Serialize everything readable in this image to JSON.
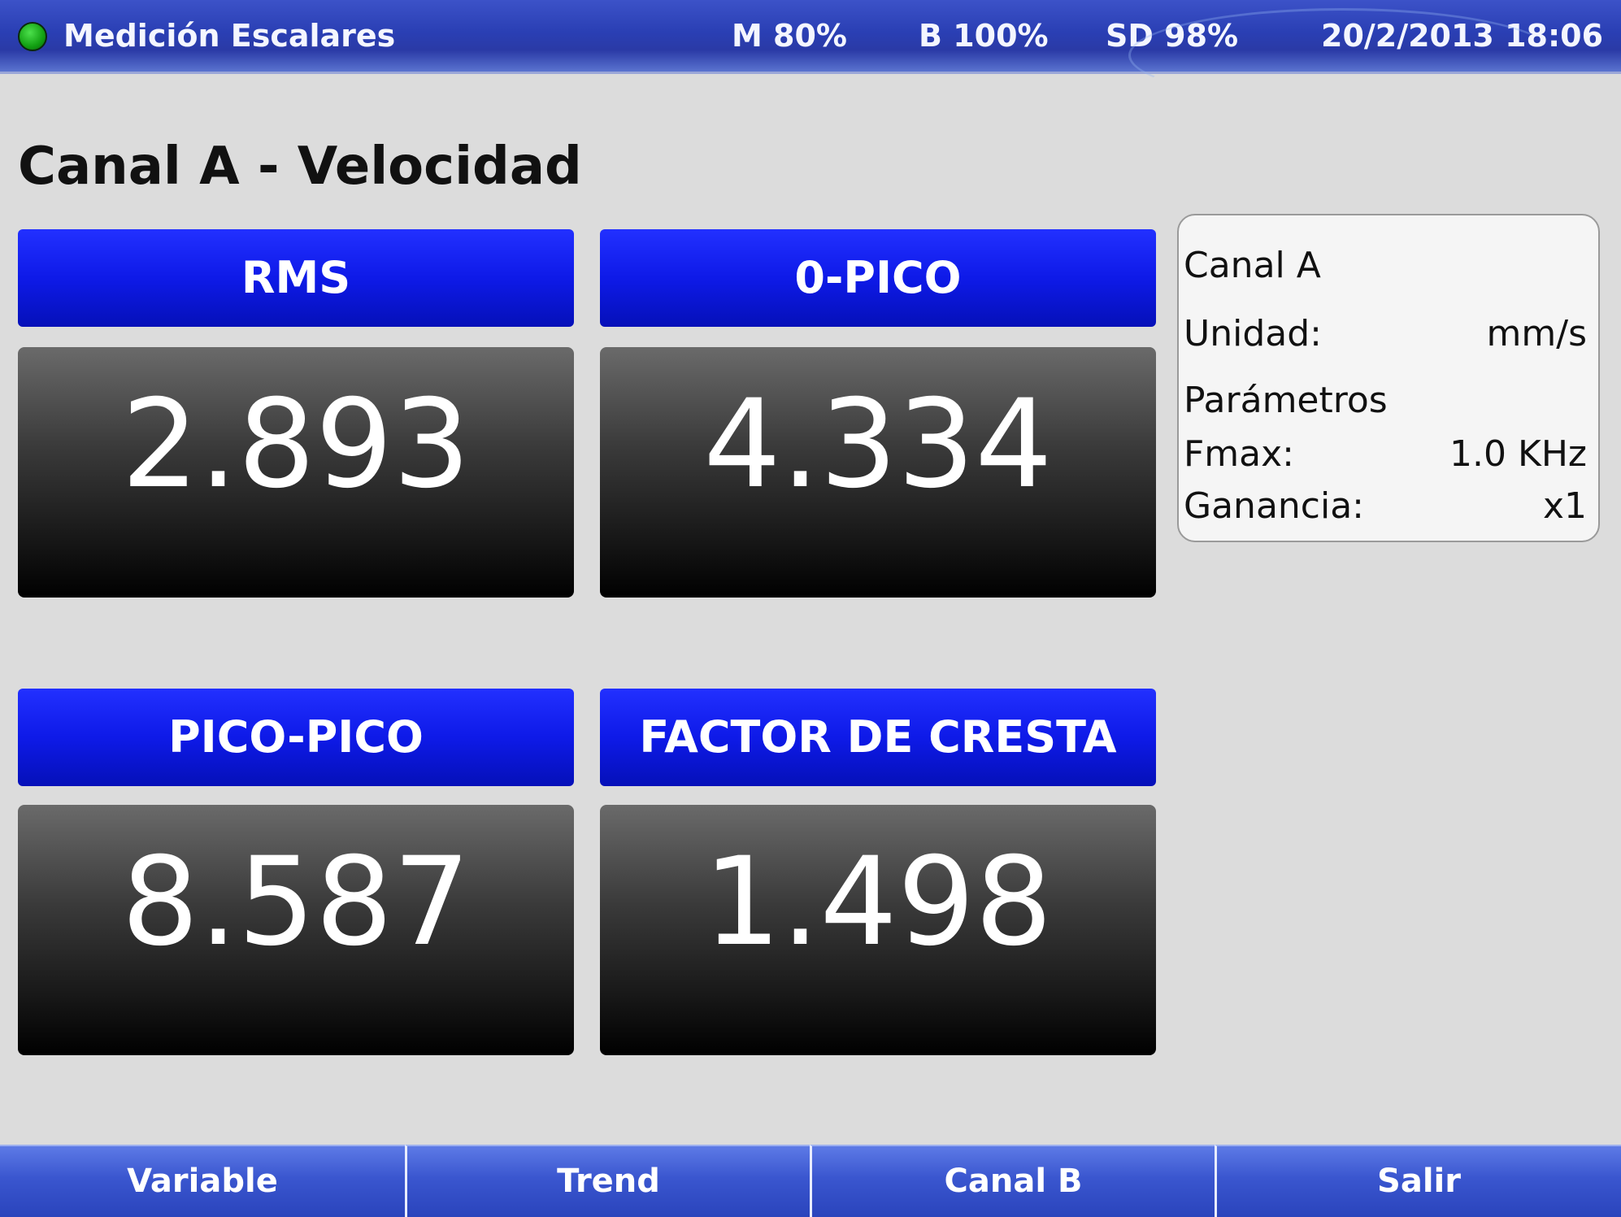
{
  "status_bar": {
    "title": "Medición Escalares",
    "memory": "M 80%",
    "battery": "B 100%",
    "sd_card": "SD 98%",
    "datetime": "20/2/2013 18:06",
    "status_indicator_color": "#1ca81c"
  },
  "page": {
    "title": "Canal A - Velocidad"
  },
  "measurements": [
    {
      "label": "RMS",
      "value": "2.893"
    },
    {
      "label": "0-PICO",
      "value": "4.334"
    },
    {
      "label": "PICO-PICO",
      "value": "8.587"
    },
    {
      "label": "FACTOR DE CRESTA",
      "value": "1.498"
    }
  ],
  "info_panel": {
    "channel": "Canal A",
    "unit_label": "Unidad:",
    "unit_value": "mm/s",
    "params_heading": "Parámetros",
    "fmax_label": "Fmax:",
    "fmax_value": "1.0 KHz",
    "gain_label": "Ganancia:",
    "gain_value": "x1"
  },
  "function_keys": [
    {
      "label": "Variable"
    },
    {
      "label": "Trend"
    },
    {
      "label": "Canal B"
    },
    {
      "label": "Salir"
    }
  ],
  "colors": {
    "header_blue": "#0e1ae8",
    "status_bar_blue": "#2a3fb4",
    "value_background": "#000000",
    "screen_background": "#dcdcdc"
  }
}
